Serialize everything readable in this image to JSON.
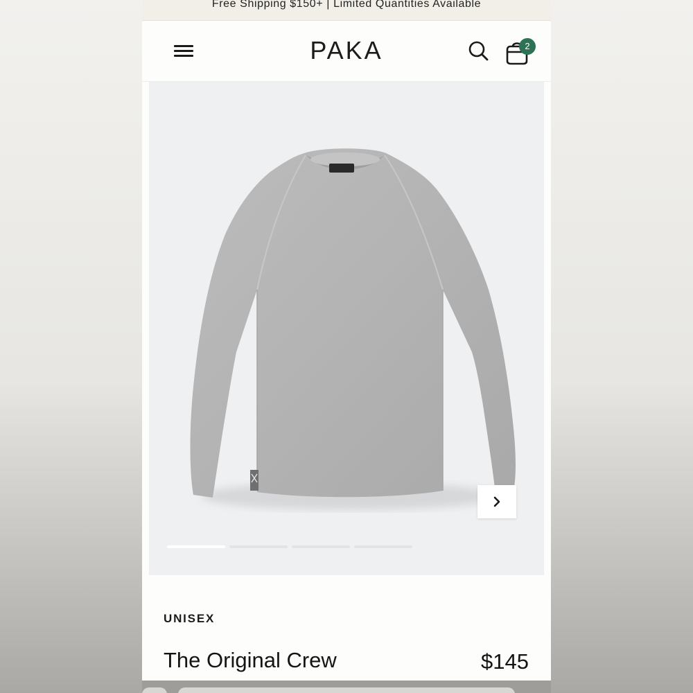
{
  "promo_bar": {
    "text": "Free Shipping $150+ | Limited Quantities Available"
  },
  "header": {
    "logo": "PAKA",
    "menu_icon": "hamburger-menu-icon",
    "search_icon": "search-icon",
    "cart_icon": "shopping-bag-icon",
    "cart_count": "2"
  },
  "gallery": {
    "image": "grey-crewneck-sweater",
    "next_icon": "chevron-right-icon",
    "slide_count": 4,
    "active_slide": 1
  },
  "product": {
    "category": "UNISEX",
    "title": "The Original Crew",
    "price": "$145"
  },
  "colors": {
    "badge": "#2d7255",
    "promo_bg": "#f1efe7",
    "gallery_bg": "#eff0f2",
    "sweater": "#b4b4b4"
  }
}
